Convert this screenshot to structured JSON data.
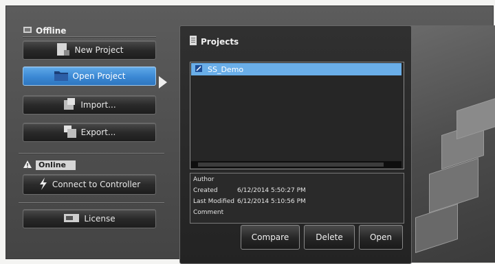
{
  "offline": {
    "title": "Offline",
    "buttons": [
      {
        "label": "New Project",
        "icon": "new-project-icon"
      },
      {
        "label": "Open Project",
        "icon": "folder-icon",
        "active": true
      },
      {
        "label": "Import...",
        "icon": "import-icon"
      },
      {
        "label": "Export...",
        "icon": "export-icon"
      }
    ]
  },
  "online": {
    "title": "Online",
    "connect_label": "Connect to Controller"
  },
  "license": {
    "label": "License"
  },
  "projects": {
    "title": "Projects",
    "items": [
      {
        "name": "SS_Demo",
        "selected": true
      }
    ],
    "details": {
      "author_label": "Author",
      "author_value": "",
      "created_label": "Created",
      "created_value": "6/12/2014 5:50:27 PM",
      "modified_label": "Last Modified",
      "modified_value": "6/12/2014 5:10:56 PM",
      "comment_label": "Comment",
      "comment_value": ""
    },
    "actions": {
      "compare": "Compare",
      "delete": "Delete",
      "open": "Open"
    }
  },
  "colors": {
    "accent": "#5ea8e8",
    "panel": "#2a2a2a",
    "frame": "#565656"
  }
}
